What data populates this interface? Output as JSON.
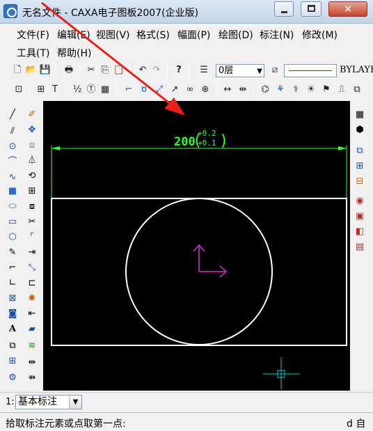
{
  "window": {
    "title": "无名文件 - CAXA电子图板2007(企业版)",
    "min_glyph": "",
    "close_glyph": "✕"
  },
  "menu": {
    "items": [
      "文件(F)",
      "编辑(E)",
      "视图(V)",
      "格式(S)",
      "幅面(P)",
      "绘图(D)",
      "标注(N)",
      "修改(M)",
      "工具(T)",
      "帮助(H)"
    ]
  },
  "toolbar": {
    "layer_value": "0层",
    "linetype_value": "BYLAYER"
  },
  "canvas": {
    "dimension_text": "200",
    "tolerance_upper": "+0.2",
    "tolerance_lower": "+0.1"
  },
  "command": {
    "index_label": "1:",
    "mode_value": "基本标注"
  },
  "status": {
    "prompt": "拾取标注元素或点取第一点:",
    "right_text": "d 自"
  },
  "colors": {
    "canvas_bg": "#000000",
    "dimension_green": "#33ff33",
    "geometry_white": "#ffffff",
    "ucs_magenta": "#cc33cc",
    "cursor_cyan": "#00cccc",
    "annotation_arrow": "#e8221a"
  }
}
